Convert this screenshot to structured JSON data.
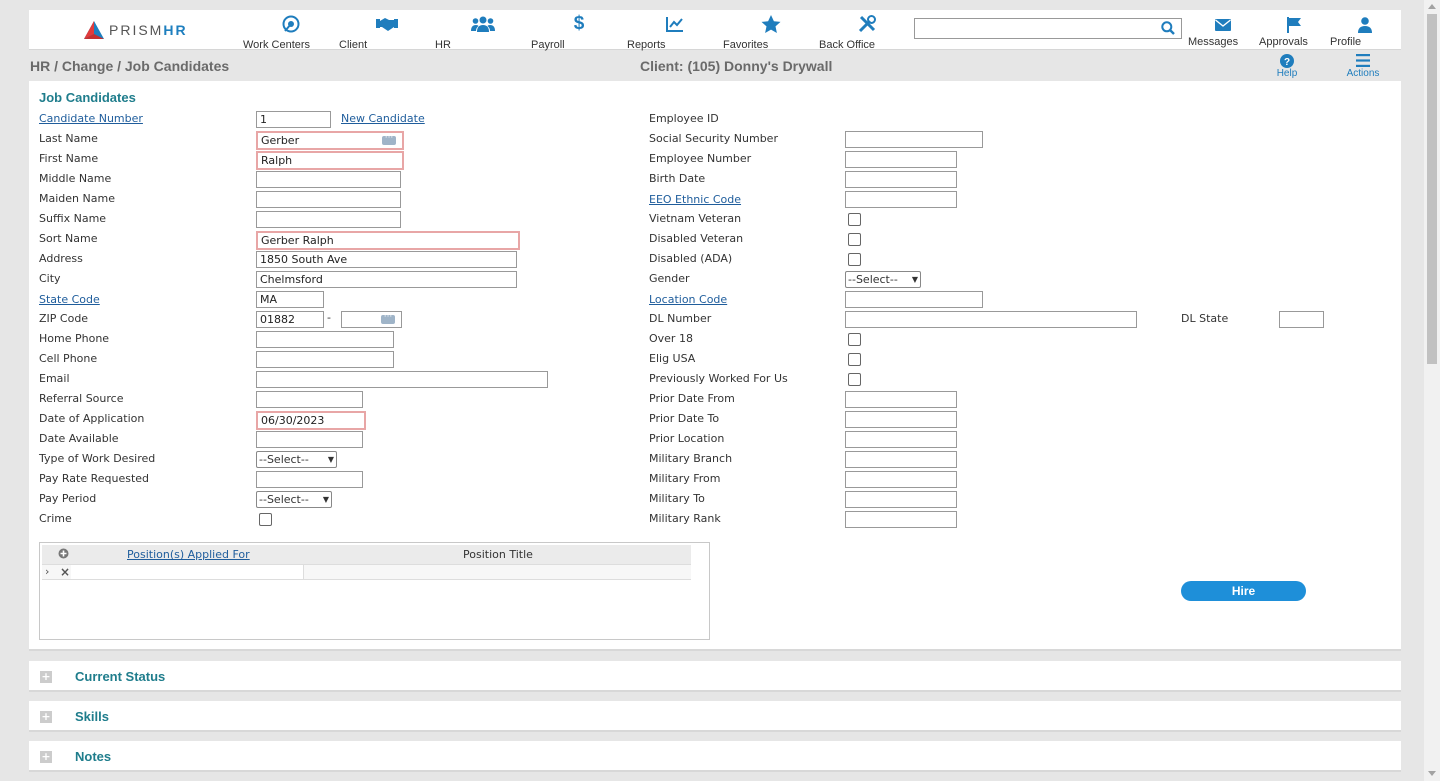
{
  "brand": {
    "logo_prefix": "PRISM",
    "logo_suffix": "HR",
    "accent": "#1f7dbd",
    "logo_colors": [
      "#e23b3b",
      "#1e7fbf"
    ]
  },
  "nav": [
    {
      "label": "Work Centers",
      "icon": "work-centers-icon"
    },
    {
      "label": "Client",
      "icon": "handshake-icon"
    },
    {
      "label": "HR",
      "icon": "people-icon"
    },
    {
      "label": "Payroll",
      "icon": "dollar-icon"
    },
    {
      "label": "Reports",
      "icon": "chart-icon"
    },
    {
      "label": "Favorites",
      "icon": "star-icon"
    },
    {
      "label": "Back Office",
      "icon": "tools-icon"
    }
  ],
  "search": {
    "value": "",
    "icon": "search-icon"
  },
  "right_nav": [
    {
      "label": "Messages",
      "icon": "envelope-icon"
    },
    {
      "label": "Approvals",
      "icon": "flag-icon"
    },
    {
      "label": "Profile",
      "icon": "user-icon"
    }
  ],
  "breadcrumb": "HR / Change / Job Candidates",
  "client_title": "Client: (105) Donny's Drywall",
  "subbar": {
    "help": "Help",
    "actions": "Actions"
  },
  "panel_title": "Job Candidates",
  "left": {
    "candidate_number": {
      "label": "Candidate Number",
      "value": "1",
      "new_link": "New Candidate"
    },
    "last_name": {
      "label": "Last Name",
      "value": "Gerber"
    },
    "first_name": {
      "label": "First Name",
      "value": "Ralph"
    },
    "middle_name": {
      "label": "Middle Name",
      "value": ""
    },
    "maiden_name": {
      "label": "Maiden Name",
      "value": ""
    },
    "suffix_name": {
      "label": "Suffix Name",
      "value": ""
    },
    "sort_name": {
      "label": "Sort Name",
      "value": "Gerber Ralph"
    },
    "address": {
      "label": "Address",
      "value": "1850 South Ave"
    },
    "city": {
      "label": "City",
      "value": "Chelmsford"
    },
    "state_code": {
      "label": "State Code",
      "value": "MA"
    },
    "zip_code": {
      "label": "ZIP Code",
      "value": "01882",
      "separator": "-",
      "ext": ""
    },
    "home_phone": {
      "label": "Home Phone",
      "value": ""
    },
    "cell_phone": {
      "label": "Cell Phone",
      "value": ""
    },
    "email": {
      "label": "Email",
      "value": ""
    },
    "referral_source": {
      "label": "Referral Source",
      "value": ""
    },
    "date_of_application": {
      "label": "Date of Application",
      "value": "06/30/2023"
    },
    "date_available": {
      "label": "Date Available",
      "value": ""
    },
    "type_of_work": {
      "label": "Type of Work Desired",
      "value": "--Select--"
    },
    "pay_rate": {
      "label": "Pay Rate Requested",
      "value": ""
    },
    "pay_period": {
      "label": "Pay Period",
      "value": "--Select--"
    },
    "crime": {
      "label": "Crime",
      "checked": false
    }
  },
  "right": {
    "employee_id": {
      "label": "Employee ID",
      "value": ""
    },
    "ssn": {
      "label": "Social Security Number",
      "value": ""
    },
    "employee_number": {
      "label": "Employee Number",
      "value": ""
    },
    "birth_date": {
      "label": "Birth Date",
      "value": ""
    },
    "eeo": {
      "label": "EEO Ethnic Code",
      "value": ""
    },
    "vietnam_veteran": {
      "label": "Vietnam Veteran",
      "checked": false
    },
    "disabled_veteran": {
      "label": "Disabled Veteran",
      "checked": false
    },
    "disabled_ada": {
      "label": "Disabled (ADA)",
      "checked": false
    },
    "gender": {
      "label": "Gender",
      "value": "--Select--"
    },
    "location_code": {
      "label": "Location Code",
      "value": ""
    },
    "dl_number": {
      "label": "DL Number",
      "value": ""
    },
    "dl_state": {
      "label": "DL State",
      "value": ""
    },
    "over_18": {
      "label": "Over 18",
      "checked": false
    },
    "elig_usa": {
      "label": "Elig USA",
      "checked": false
    },
    "previously_worked": {
      "label": "Previously Worked For Us",
      "checked": false
    },
    "prior_date_from": {
      "label": "Prior Date From",
      "value": ""
    },
    "prior_date_to": {
      "label": "Prior Date To",
      "value": ""
    },
    "prior_location": {
      "label": "Prior Location",
      "value": ""
    },
    "military_branch": {
      "label": "Military Branch",
      "value": ""
    },
    "military_from": {
      "label": "Military From",
      "value": ""
    },
    "military_to": {
      "label": "Military To",
      "value": ""
    },
    "military_rank": {
      "label": "Military Rank",
      "value": ""
    }
  },
  "grid": {
    "col_positions": "Position(s) Applied For",
    "col_title": "Position Title",
    "rows": [
      {
        "position": "",
        "title": ""
      }
    ]
  },
  "hire_button": "Hire",
  "sections": [
    "Current Status",
    "Skills",
    "Notes"
  ]
}
